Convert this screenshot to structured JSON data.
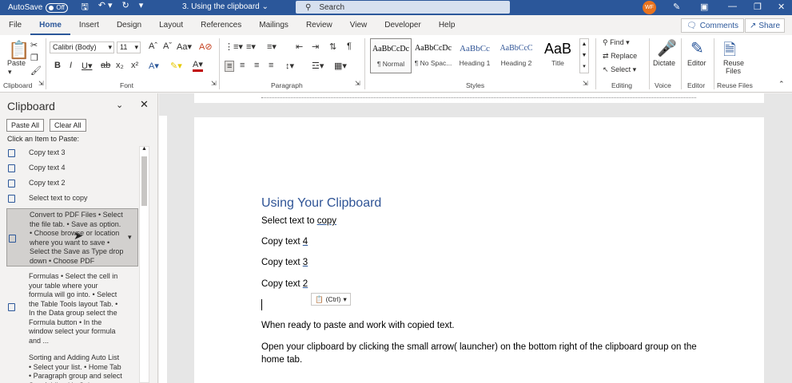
{
  "titlebar": {
    "autosave_label": "AutoSave",
    "autosave_state": "Off",
    "doc_title": "3. Using the clipboard",
    "search_placeholder": "Search",
    "avatar_initials": "WF",
    "accent": "#2b579a"
  },
  "tabs": [
    "File",
    "Home",
    "Insert",
    "Design",
    "Layout",
    "References",
    "Mailings",
    "Review",
    "View",
    "Developer",
    "Help"
  ],
  "active_tab": "Home",
  "comments_label": "Comments",
  "share_label": "Share",
  "ribbon": {
    "clipboard": {
      "paste": "Paste",
      "group": "Clipboard"
    },
    "font": {
      "name": "Calibri (Body)",
      "size": "11",
      "group": "Font"
    },
    "paragraph": {
      "group": "Paragraph"
    },
    "styles": {
      "group": "Styles",
      "items": [
        {
          "sample": "AaBbCcDc",
          "name": "¶ Normal"
        },
        {
          "sample": "AaBbCcDc",
          "name": "¶ No Spac..."
        },
        {
          "sample": "AaBbCc",
          "name": "Heading 1"
        },
        {
          "sample": "AaBbCcC",
          "name": "Heading 2"
        },
        {
          "sample": "AaB",
          "name": "Title"
        }
      ]
    },
    "editing": {
      "find": "Find",
      "replace": "Replace",
      "select": "Select",
      "group": "Editing"
    },
    "voice": {
      "dictate": "Dictate",
      "group": "Voice"
    },
    "editor": {
      "label": "Editor",
      "group": "Editor"
    },
    "reuse": {
      "label1": "Reuse",
      "label2": "Files",
      "group": "Reuse Files"
    }
  },
  "clipboard_pane": {
    "title": "Clipboard",
    "paste_all": "Paste All",
    "clear_all": "Clear All",
    "instruction": "Click an Item to Paste:",
    "items": [
      "Copy text 3",
      "Copy text 4",
      "Copy text 2",
      "Select text to copy",
      "Convert to PDF Files • Select the file tab. • Save as option. • Choose browse or location where you want to save • Select the Save as Type drop down • Choose PDF",
      "Formulas • Select the cell in your table where your formula will go into. • Select the Table Tools layout Tab. • In the Data group select the Formula button • In the window select your formula and ...",
      "Sorting and Adding Auto List • Select your list. • Home Tab • Paragraph group and select Sort Adding Up Select"
    ]
  },
  "document": {
    "heading": "Using Your Clipboard",
    "line1_a": "Select text to ",
    "line1_b": "copy",
    "line2_a": "Copy text ",
    "line2_b": "4",
    "line3_a": "Copy text ",
    "line3_b": "3",
    "line4_a": "Copy text ",
    "line4_b": "2",
    "paste_options": "(Ctrl)",
    "para1": "When ready to paste and work with copied text.",
    "para2": "Open your clipboard by clicking the small arrow( launcher)  on the bottom right of the clipboard group on the home tab."
  }
}
